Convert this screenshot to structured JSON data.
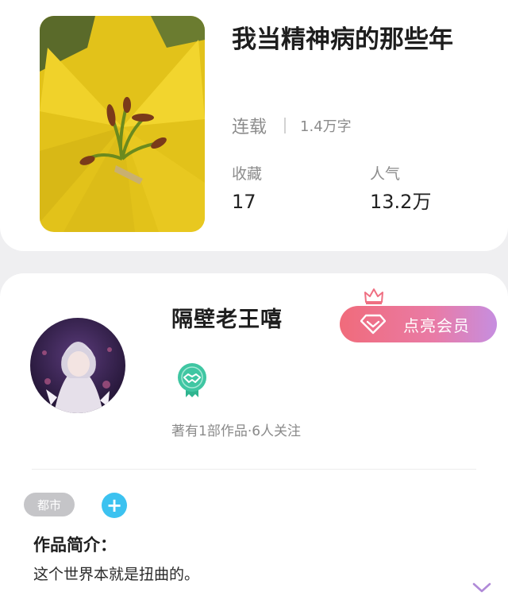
{
  "book": {
    "title": "我当精神病的那些年",
    "status": "连载",
    "word_count": "1.4万字",
    "favorites_label": "收藏",
    "favorites_value": "17",
    "popularity_label": "人气",
    "popularity_value": "13.2万"
  },
  "author": {
    "name": "隔壁老王嘻",
    "meta": "著有1部作品·6人关注",
    "vip_button_label": "点亮会员"
  },
  "tags": [
    "都市"
  ],
  "intro": {
    "heading": "作品简介：",
    "text": "这个世界本就是扭曲的。"
  },
  "icons": {
    "cover": "yellow-lily-image",
    "avatar": "anime-character-avatar",
    "vip": "diamond-icon",
    "crown": "crown-icon",
    "badge": "handshake-badge-icon",
    "add": "plus-icon",
    "expand": "chevron-down-icon"
  },
  "colors": {
    "vip_gradient_start": "#f06b7b",
    "vip_gradient_end": "#c68ee0",
    "add_button": "#3cc2f0",
    "badge": "#3fc6a2"
  }
}
